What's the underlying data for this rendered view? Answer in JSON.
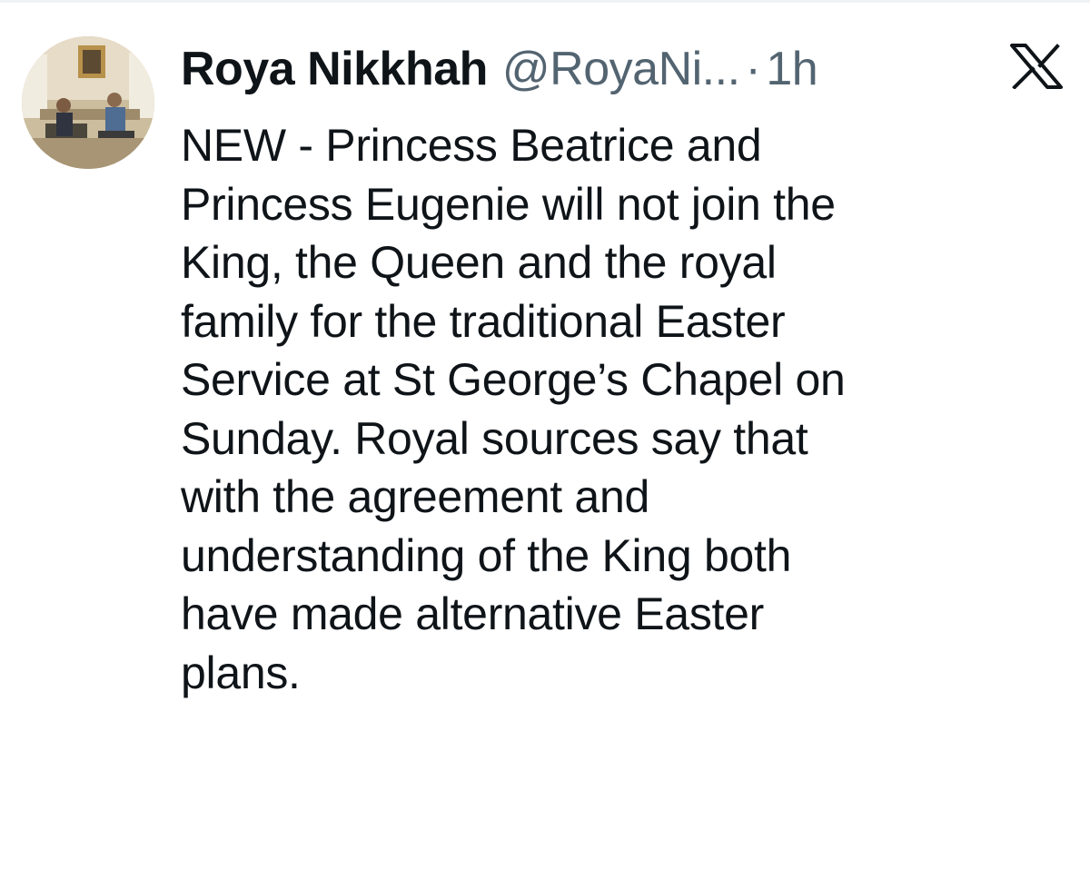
{
  "tweet": {
    "display_name": "Roya Nikkhah",
    "handle": "@RoyaNi...",
    "separator": "·",
    "timestamp": "1h",
    "logo_icon": "x-logo-icon",
    "avatar_icon": "profile-photo",
    "text": "NEW - Princess Beatrice and\nPrincess Eugenie will not join the\nKing, the Queen and the royal\nfamily for the traditional Easter\nService at St George’s Chapel on\nSunday. Royal sources say that\nwith the agreement and\nunderstanding of the King both\nhave made alternative Easter\nplans."
  },
  "colors": {
    "text_primary": "#0f1419",
    "text_secondary": "#536471",
    "background": "#ffffff"
  }
}
